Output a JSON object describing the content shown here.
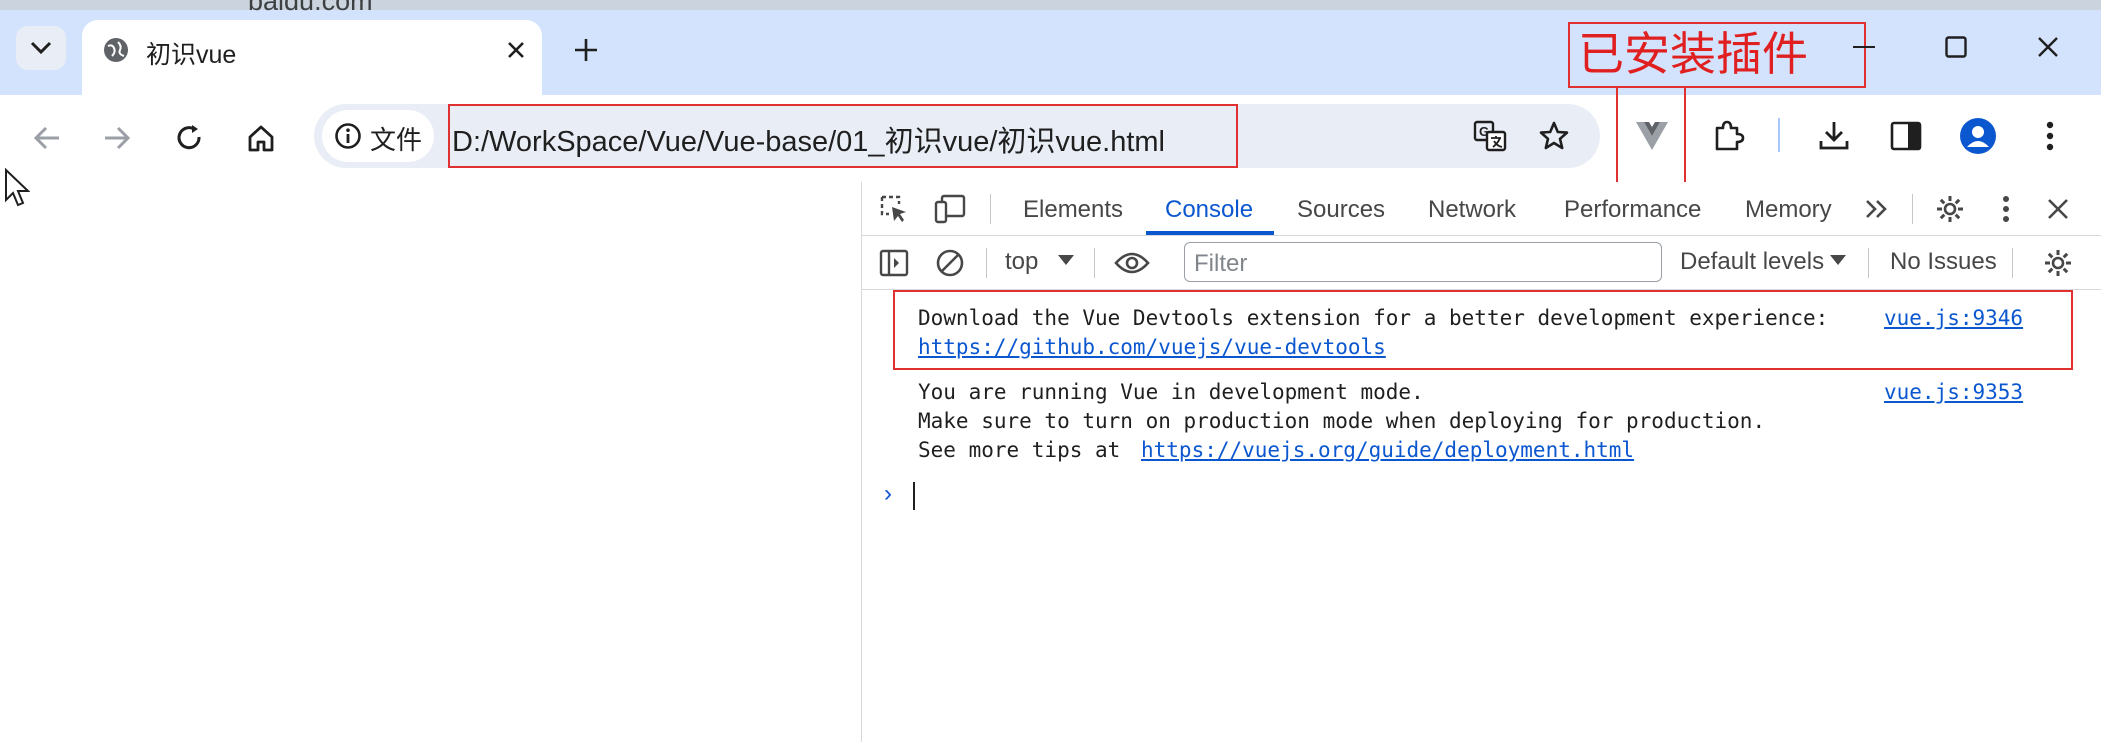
{
  "browser": {
    "background_window_title": "baidu.com",
    "tab": {
      "title": "初识vue"
    },
    "annotation": "已安装插件",
    "security_chip_label": "文件",
    "url": "D:/WorkSpace/Vue/Vue-base/01_初识vue/初识vue.html"
  },
  "devtools": {
    "tabs": [
      "Elements",
      "Console",
      "Sources",
      "Network",
      "Performance",
      "Memory"
    ],
    "active_tab": "Console",
    "console_toolbar": {
      "context": "top",
      "filter_placeholder": "Filter",
      "levels": "Default levels",
      "issues": "No Issues"
    },
    "messages": [
      {
        "line1": "Download the Vue Devtools extension for a better development experience:",
        "link": "https://github.com/vuejs/vue-devtools",
        "source": "vue.js:9346"
      },
      {
        "line1": "You are running Vue in development mode.",
        "line2": "Make sure to turn on production mode when deploying for production.",
        "line3_prefix": "See more tips at ",
        "line3_link": "https://vuejs.org/guide/deployment.html",
        "source": "vue.js:9353"
      }
    ]
  },
  "colors": {
    "titlebar": "#d3e3fd",
    "accent": "#0b57d0",
    "annotation_red": "#e03030"
  }
}
